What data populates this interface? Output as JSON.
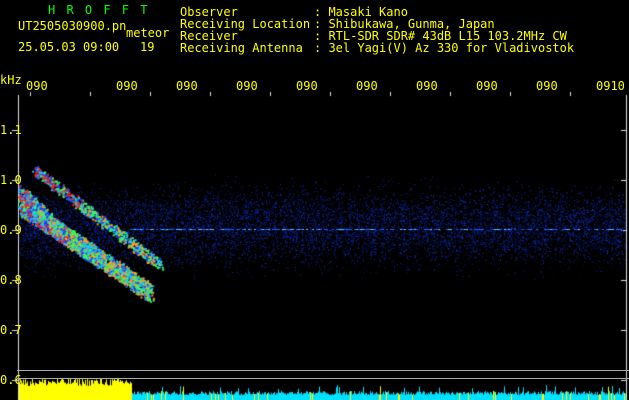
{
  "header": {
    "logo_text": "H R O F F T",
    "filename": "UT2505030900.pn",
    "kind": "meteor",
    "datetime": "25.05.03 09:00",
    "count": "19",
    "fields": [
      {
        "label": "Observer",
        "value": ": Masaki Kano"
      },
      {
        "label": "Receiving Location",
        "value": ": Shibukawa, Gunma, Japan"
      },
      {
        "label": "Receiver",
        "value": ": RTL-SDR SDR# 43dB L15 103.2MHz CW"
      },
      {
        "label": "Receiving Antenna",
        "value": ": 3el Yagi(V) Az 330 for Vladivostok"
      }
    ]
  },
  "axis": {
    "unit": "kHz",
    "y_ticks": [
      "1.1",
      "1.0",
      "0.9",
      "0.8",
      "0.7",
      "0.6"
    ],
    "time_ticks": [
      "090",
      "090",
      "090",
      "090",
      "090",
      "090",
      "090",
      "090",
      "090",
      "0910"
    ]
  },
  "colors": {
    "label": "#ffff00",
    "logo": "#00ff00",
    "background": "#000000",
    "echo_strong": "#ff2020",
    "echo_mid": "#30ff60",
    "noise": "#1030ff",
    "level_bar_high": "#ffff00",
    "level_bar_low": "#00e0ff"
  }
}
